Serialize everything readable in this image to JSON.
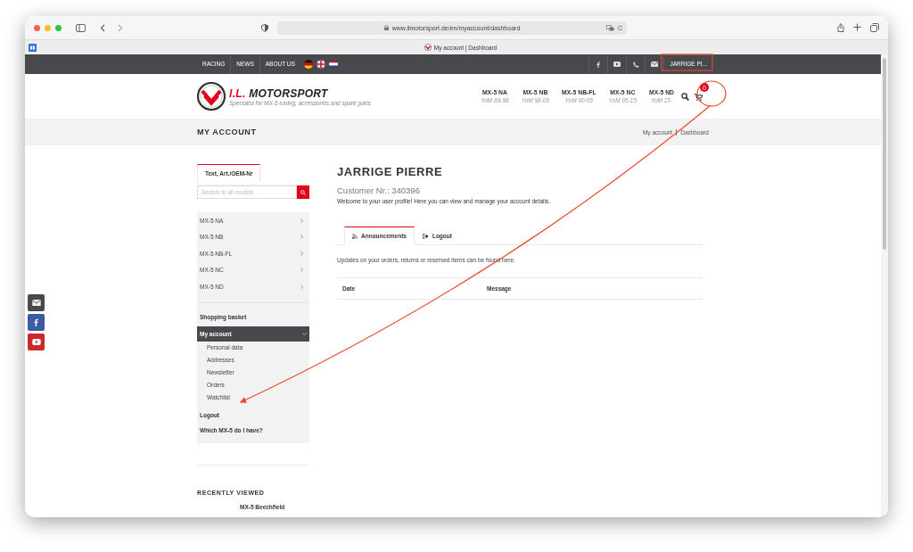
{
  "browser": {
    "url": "www.ilmotorsport.de/en/myaccount/dashboard",
    "tab_title": "My account | Dashboard"
  },
  "top_bar": {
    "nav": [
      "RACING",
      "NEWS",
      "ABOUT US"
    ],
    "user": "JARRIGE PI..."
  },
  "header": {
    "brand_initials": "I.L.",
    "brand_name": "MOTORSPORT",
    "tagline": "Specialist for MX-5 tuning, accessories and spare parts",
    "cart_count": "0",
    "models": [
      {
        "name": "MX-5 NA",
        "years": "YoM 89-98"
      },
      {
        "name": "MX-5 NB",
        "years": "YoM 98-00"
      },
      {
        "name": "MX-5 NB-FL",
        "years": "YoM 00-05"
      },
      {
        "name": "MX-5 NC",
        "years": "YoM 05-15"
      },
      {
        "name": "MX-5 ND",
        "years": "YoM 15-"
      }
    ]
  },
  "page_title": "MY ACCOUNT",
  "breadcrumb": [
    "My account",
    "Dashboard"
  ],
  "sidebar": {
    "search_tab": "Text, Art./OEM-Nr",
    "search_placeholder": "Search in all models",
    "models": [
      "MX-5 NA",
      "MX-5 NB",
      "MX-5 NB-FL",
      "MX-5 NC",
      "MX-5 ND"
    ],
    "menu": [
      {
        "label": "Shopping basket",
        "expanded": false
      },
      {
        "label": "My account",
        "expanded": true,
        "children": [
          "Personal data",
          "Addresses",
          "Newsletter",
          "Orders",
          "Watchlist"
        ]
      },
      {
        "label": "Logout",
        "expanded": false
      },
      {
        "label": "Which MX-5 do I have?",
        "expanded": false
      }
    ]
  },
  "main": {
    "name": "JARRIGE PIERRE",
    "customer_nr": "Customer Nr.: 340396",
    "welcome": "Welcome to your user profile! Here you can view and manage your account details.",
    "tabs": [
      {
        "label": "Announcements",
        "selected": true
      },
      {
        "label": "Logout",
        "selected": false
      }
    ],
    "updates": "Updates on your orders, returns or reserved items can be found here.",
    "columns": [
      "Date",
      "Message"
    ]
  },
  "recently_viewed": {
    "title": "RECENTLY VIEWED",
    "items": [
      "MX-5 Beechfield"
    ]
  }
}
